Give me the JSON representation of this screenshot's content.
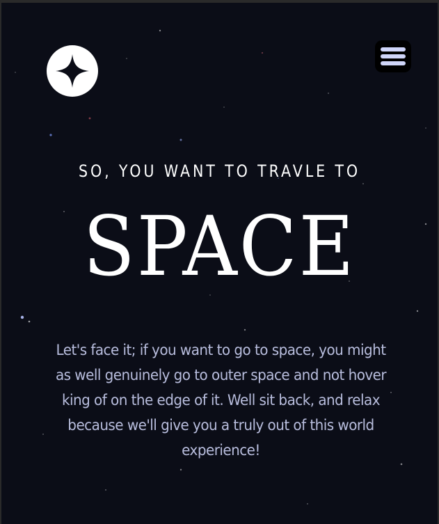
{
  "hero": {
    "subtitle": "SO, YOU WANT TO TRAVLE TO",
    "title": "SPACE",
    "description": "Let's face it; if you want to go to space, you might as well genuinely go to outer space and not hover king of on the edge of it. Well sit back, and relax because we'll give you a truly out of this world experience!"
  },
  "header": {
    "logo_icon": "four-point-star-icon",
    "menu_icon": "hamburger-menu-icon"
  },
  "colors": {
    "background": "#0b0d17",
    "accent": "#d0d6f9",
    "text": "#ffffff"
  }
}
